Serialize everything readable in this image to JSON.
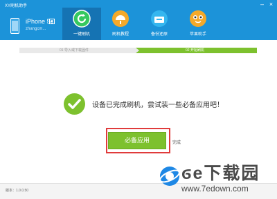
{
  "app": {
    "title": "XY刷机助手"
  },
  "window_controls": [
    {
      "name": "minimize-button",
      "glyph": "–"
    },
    {
      "name": "close-button",
      "glyph": "×"
    }
  ],
  "device": {
    "name": "iPhone 5c",
    "account": "zhangcm..."
  },
  "nav": {
    "active": 0,
    "tabs": [
      {
        "label": "一键刷机",
        "icon": "refresh-icon",
        "color": "#35c85f"
      },
      {
        "label": "刷机教程",
        "icon": "lamp-icon",
        "color": "#f4a92a"
      },
      {
        "label": "备份还原",
        "icon": "backup-box-icon",
        "color": "#35b6ef"
      },
      {
        "label": "苹果助手",
        "icon": "smiley-icon",
        "color": "#f4a92a"
      }
    ]
  },
  "steps": {
    "step1": "01 导入或下载固件",
    "step2": "02 开始刷机",
    "current": 2
  },
  "result": {
    "message": "设备已完成刷机，尝试装一些必备应用吧！",
    "primary_button": "必备应用",
    "secondary_link": "完成"
  },
  "footer": {
    "version": "版本：1.0.0.50"
  },
  "watermark": {
    "brand": "ϭe下载园",
    "url": "www.7edown.com"
  },
  "colors": {
    "header": "#1c93d9",
    "accent_green": "#7dc12e",
    "highlight_red": "#e03b3b"
  }
}
